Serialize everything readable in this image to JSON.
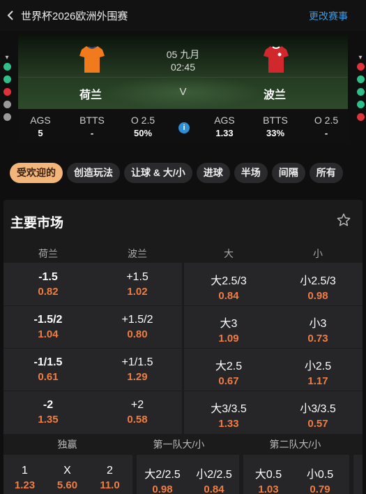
{
  "header": {
    "title": "世界杯2026欧洲外围赛",
    "action": "更改赛事"
  },
  "match": {
    "date": "05 九月",
    "time": "02:45",
    "vs": "V",
    "home": {
      "name": "荷兰",
      "color": "#f07a1c"
    },
    "away": {
      "name": "波兰",
      "color": "#d0282c"
    }
  },
  "side_dots": {
    "left": [
      "#2fbf8a",
      "#2fbf8a",
      "#e0323a",
      "#9a9a9a",
      "#9a9a9a"
    ],
    "right": [
      "#e0323a",
      "#2fbf8a",
      "#2fbf8a",
      "#2fbf8a",
      "#e0323a"
    ]
  },
  "stats": {
    "home": [
      {
        "label": "AGS",
        "value": "5"
      },
      {
        "label": "BTTS",
        "value": "-"
      },
      {
        "label": "O 2.5",
        "value": "50%"
      }
    ],
    "away": [
      {
        "label": "AGS",
        "value": "1.33"
      },
      {
        "label": "BTTS",
        "value": "33%"
      },
      {
        "label": "O 2.5",
        "value": "-"
      }
    ],
    "info_glyph": "i"
  },
  "chips": [
    "受欢迎的",
    "创造玩法",
    "让球 & 大/小",
    "进球",
    "半场",
    "间隔",
    "所有"
  ],
  "market": {
    "title": "主要市场",
    "columns": [
      "荷兰",
      "波兰",
      "大",
      "小"
    ],
    "handicap_rows": [
      {
        "home": {
          "line": "-1.5",
          "odds": "0.82"
        },
        "away": {
          "line": "+1.5",
          "odds": "1.02"
        },
        "over": {
          "line": "大2.5/3",
          "odds": "0.84"
        },
        "under": {
          "line": "小2.5/3",
          "odds": "0.98"
        }
      },
      {
        "home": {
          "line": "-1.5/2",
          "odds": "1.04"
        },
        "away": {
          "line": "+1.5/2",
          "odds": "0.80"
        },
        "over": {
          "line": "大3",
          "odds": "1.09"
        },
        "under": {
          "line": "小3",
          "odds": "0.73"
        }
      },
      {
        "home": {
          "line": "-1/1.5",
          "odds": "0.61"
        },
        "away": {
          "line": "+1/1.5",
          "odds": "1.29"
        },
        "over": {
          "line": "大2.5",
          "odds": "0.67"
        },
        "under": {
          "line": "小2.5",
          "odds": "1.17"
        }
      },
      {
        "home": {
          "line": "-2",
          "odds": "1.35"
        },
        "away": {
          "line": "+2",
          "odds": "0.58"
        },
        "over": {
          "line": "大3/3.5",
          "odds": "1.33"
        },
        "under": {
          "line": "小3/3.5",
          "odds": "0.57"
        }
      }
    ],
    "sections": [
      "独赢",
      "第一队大/小",
      "第二队大/小"
    ],
    "bottom": {
      "moneyline": [
        {
          "label": "1",
          "odds": "1.23"
        },
        {
          "label": "X",
          "odds": "5.60"
        },
        {
          "label": "2",
          "odds": "11.0"
        }
      ],
      "team1": [
        {
          "label": "大2/2.5",
          "odds": "0.98"
        },
        {
          "label": "小2/2.5",
          "odds": "0.84"
        }
      ],
      "team2": [
        {
          "label": "大0.5",
          "odds": "1.03"
        },
        {
          "label": "小0.5",
          "odds": "0.79"
        }
      ]
    }
  }
}
